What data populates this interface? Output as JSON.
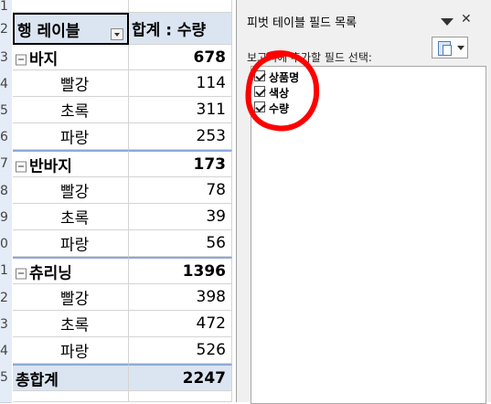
{
  "spreadsheet": {
    "header": {
      "row_label": "행 레이블",
      "value_label": "합계 : 수량"
    },
    "rows": [
      {
        "num": "2",
        "label": "",
        "value": ""
      },
      {
        "num": "3",
        "label": "바지",
        "value": "678"
      },
      {
        "num": "4",
        "label": "빨강",
        "value": "114"
      },
      {
        "num": "5",
        "label": "초록",
        "value": "311"
      },
      {
        "num": "6",
        "label": "파랑",
        "value": "253"
      },
      {
        "num": "7",
        "label": "반바지",
        "value": "173"
      },
      {
        "num": "8",
        "label": "빨강",
        "value": "78"
      },
      {
        "num": "9",
        "label": "초록",
        "value": "39"
      },
      {
        "num": "0",
        "label": "파랑",
        "value": "56"
      },
      {
        "num": "1",
        "label": "츄리닝",
        "value": "1396"
      },
      {
        "num": "2",
        "label": "빨강",
        "value": "398"
      },
      {
        "num": "3",
        "label": "초록",
        "value": "472"
      },
      {
        "num": "4",
        "label": "파랑",
        "value": "526"
      },
      {
        "num": "5",
        "label": "총합계",
        "value": "2247"
      },
      {
        "num": "1",
        "label": "",
        "value": ""
      }
    ]
  },
  "pane": {
    "title": "피벗 테이블 필드 목록",
    "instruction": "보고서에 추가할 필드 선택:",
    "fields": [
      {
        "label": "상품명",
        "checked": true
      },
      {
        "label": "색상",
        "checked": true
      },
      {
        "label": "수량",
        "checked": true
      }
    ]
  },
  "colors": {
    "header_fill": "#dbe5f1",
    "total_fill": "#dbe5f1",
    "group_border": "#8eaadb",
    "annotation": "#ff0000"
  }
}
